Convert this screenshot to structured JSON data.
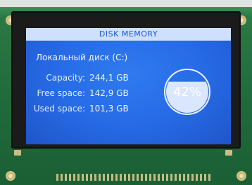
{
  "screen": {
    "title": "DISK MEMORY",
    "drive_label": "Локальный диск (C:)",
    "rows": [
      {
        "label": "Capacity:",
        "value": "244,1 GB"
      },
      {
        "label": "Free space:",
        "value": "142,9 GB"
      },
      {
        "label": "Used space:",
        "value": "101,3 GB"
      }
    ],
    "usage_percent_text": "42%",
    "usage_fraction": 0.42
  },
  "colors": {
    "lcd_blue": "#2669e4",
    "title_bar_bg": "#cfe0ff",
    "title_text": "#1d55d6",
    "pcb_green": "#1f6a3a"
  }
}
